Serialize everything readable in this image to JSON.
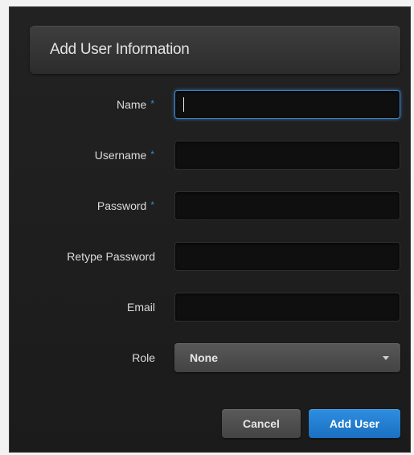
{
  "dialog": {
    "title": "Add User Information"
  },
  "form": {
    "name": {
      "label": "Name",
      "required": "*",
      "value": ""
    },
    "username": {
      "label": "Username",
      "required": "*",
      "value": ""
    },
    "password": {
      "label": "Password",
      "required": "*",
      "value": ""
    },
    "retype_password": {
      "label": "Retype Password",
      "value": ""
    },
    "email": {
      "label": "Email",
      "value": ""
    },
    "role": {
      "label": "Role",
      "selected": "None"
    }
  },
  "buttons": {
    "cancel_label": "Cancel",
    "add_label": "Add User"
  },
  "colors": {
    "accent": "#1f7fd4",
    "required_marker": "#2f8fd6"
  }
}
